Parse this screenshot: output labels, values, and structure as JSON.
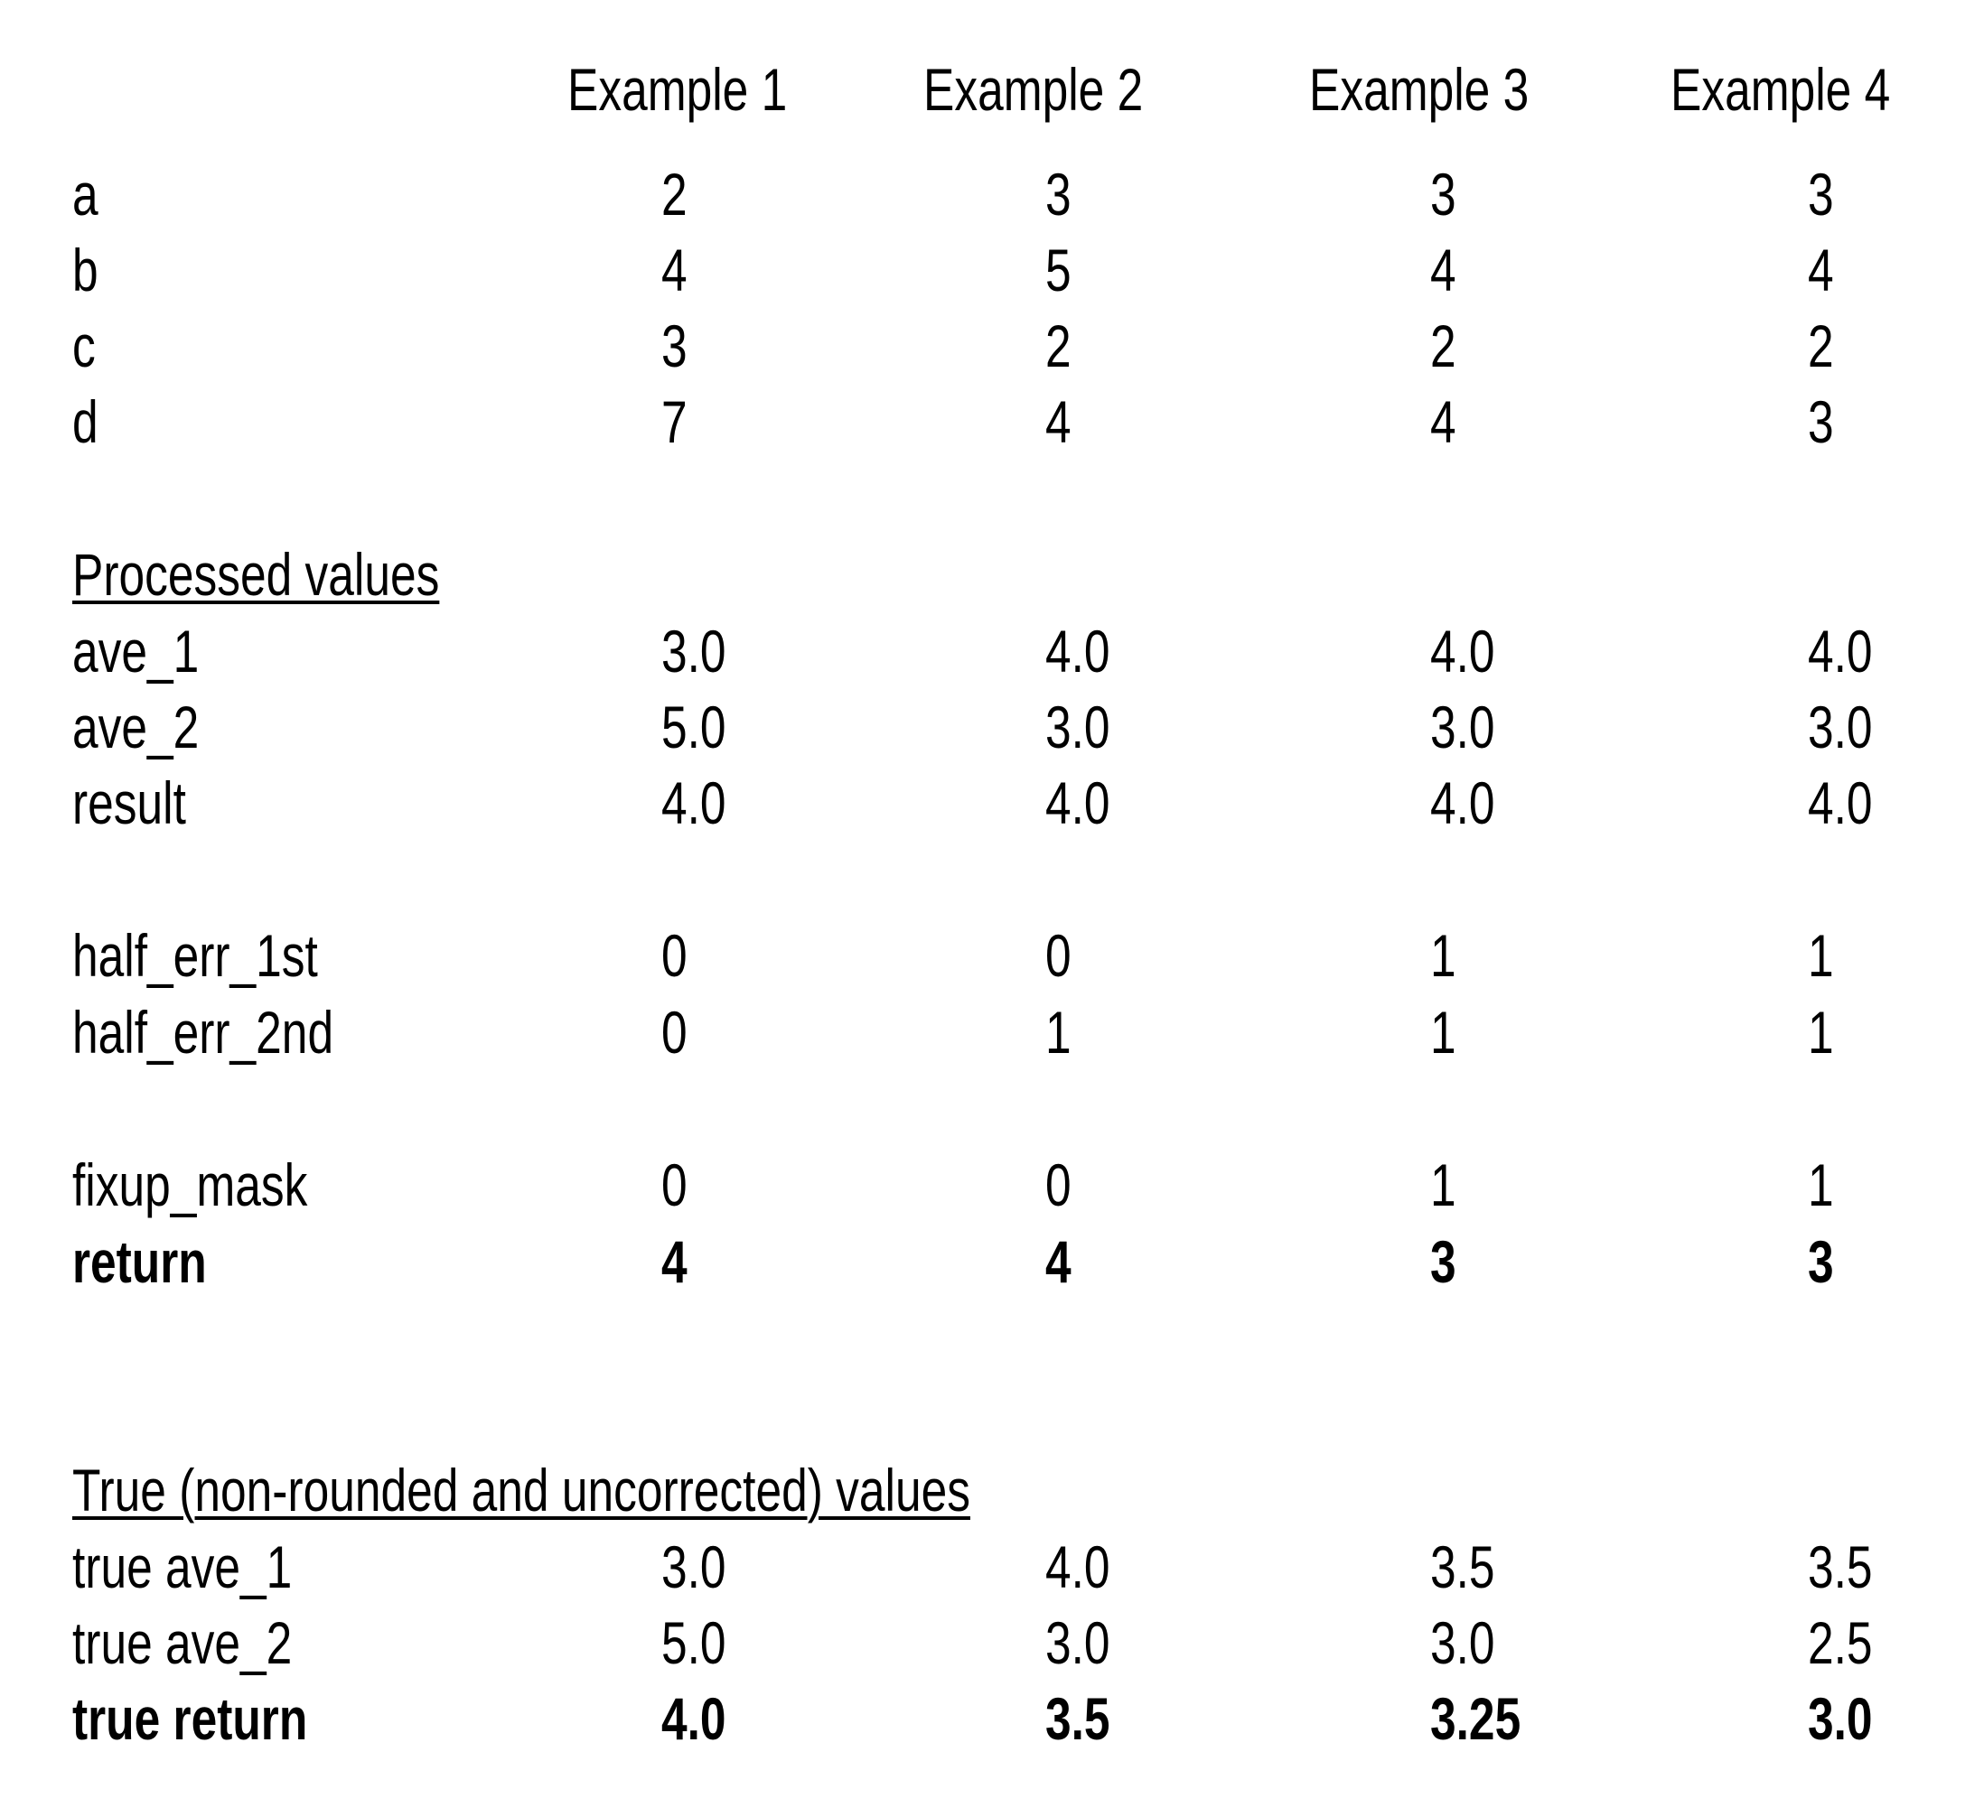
{
  "headers": [
    "Example 1",
    "Example 2",
    "Example 3",
    "Example 4"
  ],
  "inputs": [
    {
      "label": "a",
      "values": [
        "2",
        "3",
        "3",
        "3"
      ]
    },
    {
      "label": "b",
      "values": [
        "4",
        "5",
        "4",
        "4"
      ]
    },
    {
      "label": "c",
      "values": [
        "3",
        "2",
        "2",
        "2"
      ]
    },
    {
      "label": "d",
      "values": [
        "7",
        "4",
        "4",
        "3"
      ]
    }
  ],
  "processed": {
    "title": "Processed values",
    "rows": [
      {
        "label": "ave_1",
        "values": [
          "3.0",
          "4.0",
          "4.0",
          "4.0"
        ]
      },
      {
        "label": "ave_2",
        "values": [
          "5.0",
          "3.0",
          "3.0",
          "3.0"
        ]
      },
      {
        "label": "result",
        "values": [
          "4.0",
          "4.0",
          "4.0",
          "4.0"
        ]
      }
    ]
  },
  "errors": [
    {
      "label": "half_err_1st",
      "values": [
        "0",
        "0",
        "1",
        "1"
      ]
    },
    {
      "label": "half_err_2nd",
      "values": [
        "0",
        "1",
        "1",
        "1"
      ]
    }
  ],
  "fixup": {
    "label": "fixup_mask",
    "values": [
      "0",
      "0",
      "1",
      "1"
    ]
  },
  "return_row": {
    "label": "return",
    "values": [
      "4",
      "4",
      "3",
      "3"
    ]
  },
  "true_values": {
    "title": "True (non-rounded and uncorrected) values",
    "rows": [
      {
        "label": "true ave_1",
        "values": [
          "3.0",
          "4.0",
          "3.5",
          "3.5"
        ]
      },
      {
        "label": "true ave_2",
        "values": [
          "5.0",
          "3.0",
          "3.0",
          "2.5"
        ]
      }
    ],
    "return_row": {
      "label": "true return",
      "values": [
        "4.0",
        "3.5",
        "3.25",
        "3.0"
      ]
    }
  }
}
